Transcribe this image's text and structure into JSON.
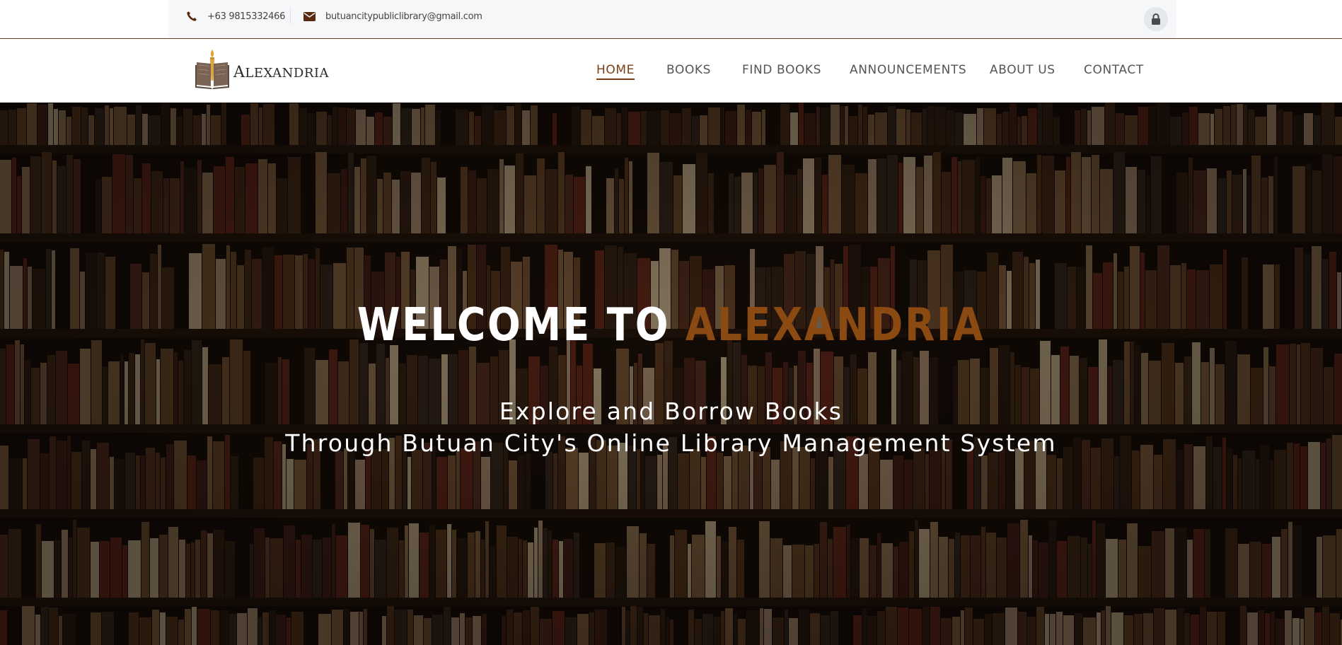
{
  "topbar": {
    "phone": "+63 9815332466",
    "email": "butuancitypubliclibrary@gmail.com",
    "phone_icon": "phone-icon",
    "email_icon": "envelope-icon",
    "lock_icon": "lock-icon"
  },
  "brand": {
    "name_first": "A",
    "name_rest": "LEXANDRIA",
    "logo_icon": "book-torch-icon"
  },
  "nav": {
    "items": [
      {
        "label": "HOME",
        "active": true
      },
      {
        "label": "BOOKS"
      },
      {
        "label": "FIND BOOKS"
      },
      {
        "label": "ANNOUNCEMENTS"
      },
      {
        "label": "ABOUT US"
      },
      {
        "label": "CONTACT"
      }
    ]
  },
  "hero": {
    "title_prefix": "WELCOME TO",
    "title_accent": "ALEXANDRIA",
    "subtitle_line1": "Explore and Borrow Books",
    "subtitle_line2": "Through Butuan City's Online Library Management System"
  },
  "colors": {
    "accent": "#8a4a12",
    "nav_active": "#7b3f14",
    "topbar_border": "#7a3a22"
  }
}
